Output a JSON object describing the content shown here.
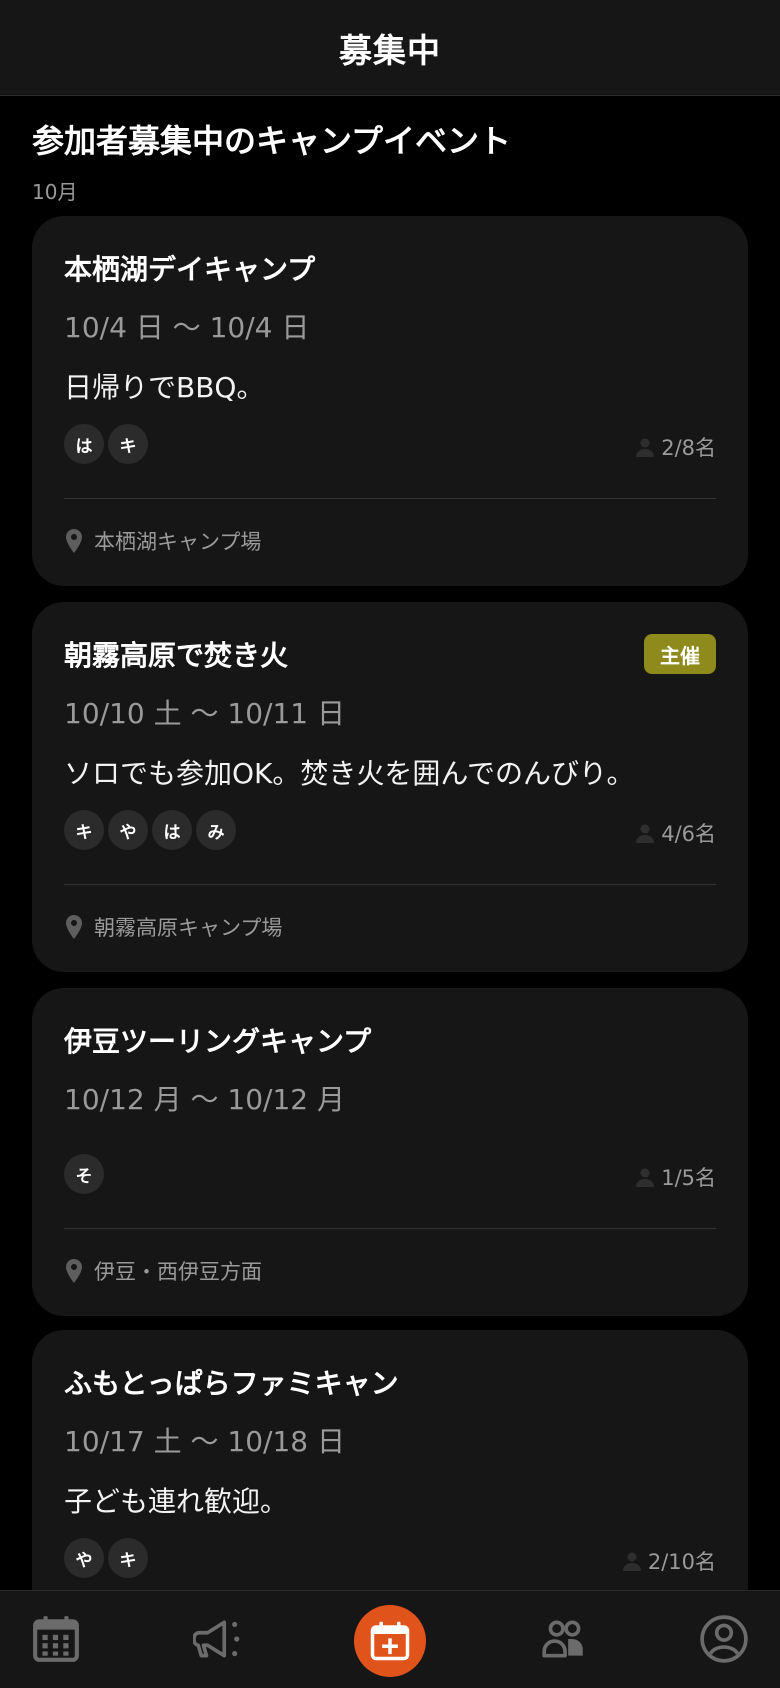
{
  "header": {
    "title": "募集中"
  },
  "section": {
    "title": "参加者募集中のキャンプイベント",
    "month": "10月"
  },
  "events": [
    {
      "title": "本栖湖デイキャンプ",
      "date": "10/4 日 〜 10/4 日",
      "description": "日帰りでBBQ。",
      "participants": [
        "は",
        "キ"
      ],
      "count": "2/8名",
      "location": "本栖湖キャンプ場",
      "badge": ""
    },
    {
      "title": "朝霧高原で焚き火",
      "date": "10/10 土 〜 10/11 日",
      "description": "ソロでも参加OK。焚き火を囲んでのんびり。",
      "participants": [
        "キ",
        "や",
        "は",
        "み"
      ],
      "count": "4/6名",
      "location": "朝霧高原キャンプ場",
      "badge": "主催"
    },
    {
      "title": "伊豆ツーリングキャンプ",
      "date": "10/12 月 〜 10/12 月",
      "description": "",
      "participants": [
        "そ"
      ],
      "count": "1/5名",
      "location": "伊豆・西伊豆方面",
      "badge": ""
    },
    {
      "title": "ふもとっぱらファミキャン",
      "date": "10/17 土 〜 10/18 日",
      "description": "子ども連れ歓迎。",
      "participants": [
        "や",
        "キ"
      ],
      "count": "2/10名",
      "location": "",
      "badge": ""
    }
  ],
  "nav": {
    "items": [
      "calendar-icon",
      "megaphone-icon",
      "calendar-plus-icon",
      "group-icon",
      "profile-icon"
    ],
    "active_color": "#e0531a"
  }
}
